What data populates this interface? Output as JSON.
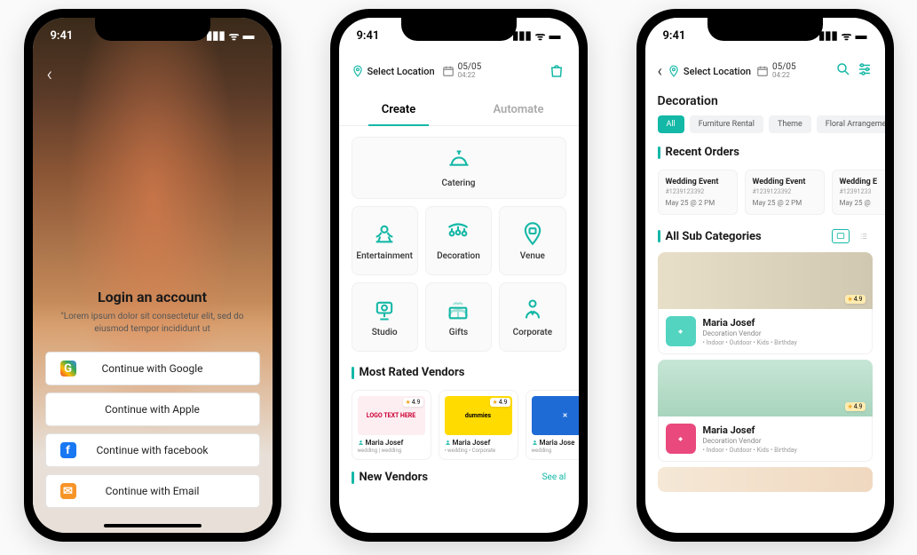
{
  "status": {
    "time": "9:41"
  },
  "phone1": {
    "title": "Login an account",
    "subtitle": "\"Lorem ipsum dolor sit consectetur elit, sed do eiusmod tempor incididunt ut",
    "buttons": {
      "google": "Continue with Google",
      "apple": "Continue with Apple",
      "facebook": "Continue with facebook",
      "email": "Continue with Email"
    }
  },
  "phone2": {
    "location": "Select Location",
    "date": "05/05",
    "time": "04:22",
    "tabs": {
      "create": "Create",
      "automate": "Automate"
    },
    "categories": {
      "catering": "Catering",
      "entertainment": "Entertainment",
      "decoration": "Decoration",
      "venue": "Venue",
      "studio": "Studio",
      "gifts": "Gifts",
      "corporate": "Corporate"
    },
    "sections": {
      "mostRated": "Most Rated Vendors",
      "newVendors": "New Vendors",
      "seeAll": "See al"
    },
    "vendors": [
      {
        "name": "Maria Josef",
        "rating": "4.9",
        "tags": "wedding | wedding",
        "logo": "LOGO TEXT HERE"
      },
      {
        "name": "Maria Josef",
        "rating": "4.9",
        "tags": "• wedding • Corporate",
        "logo": "dummies"
      },
      {
        "name": "Maria Jose",
        "rating": "",
        "tags": "wedding",
        "logo": "✕"
      }
    ]
  },
  "phone3": {
    "location": "Select Location",
    "date": "05/05",
    "time": "04:22",
    "title": "Decoration",
    "chips": [
      "All",
      "Furniture Rental",
      "Theme",
      "Floral Arrangeme"
    ],
    "recentOrdersTitle": "Recent Orders",
    "orders": [
      {
        "title": "Wedding Event",
        "id": "#1239123392",
        "date": "May 25 @ 2 PM"
      },
      {
        "title": "Wedding Event",
        "id": "#1239123392",
        "date": "May 25 @ 2 PM"
      },
      {
        "title": "Wedding E",
        "id": "#12391233",
        "date": "May 25 @"
      }
    ],
    "allSubTitle": "All Sub Categories",
    "subcards": [
      {
        "name": "Maria Josef",
        "vendor": "Decoration Vendor",
        "tags": "• Indoor   • Outdoor   • Kids   • Birthday",
        "rating": "4.9"
      },
      {
        "name": "Maria Josef",
        "vendor": "Decoration Vendor",
        "tags": "• Indoor   • Outdoor   • Kids   • Birthday",
        "rating": "4.9"
      }
    ]
  }
}
